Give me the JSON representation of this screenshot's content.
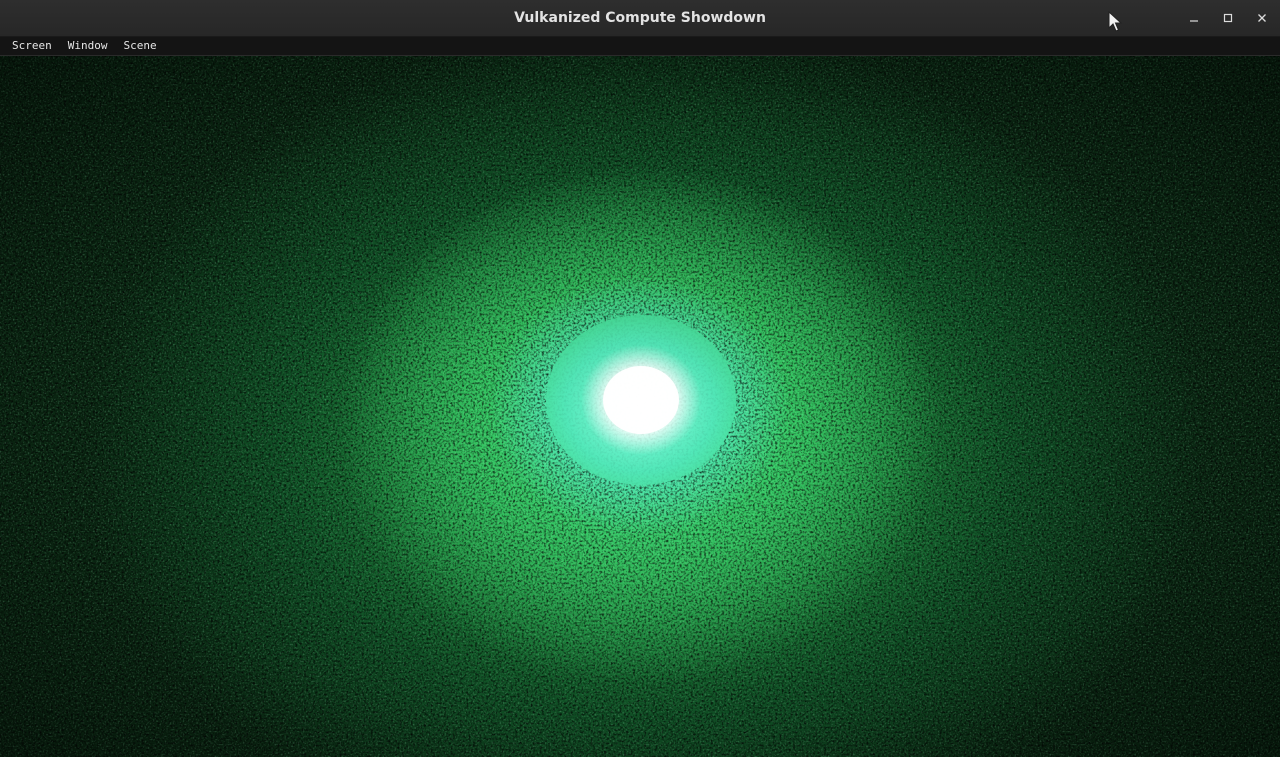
{
  "window": {
    "title": "Vulkanized Compute Showdown",
    "controls": {
      "minimize_icon": "minimize-icon",
      "maximize_icon": "maximize-icon",
      "close_icon": "close-icon"
    }
  },
  "menubar": {
    "items": [
      "Screen",
      "Window",
      "Scene"
    ]
  },
  "scene": {
    "description_colors": {
      "core": "#ffffff",
      "inner_glow": "#7ff5e0",
      "mid_glow": "#3ee07a",
      "outer": "#0c2d15"
    }
  }
}
